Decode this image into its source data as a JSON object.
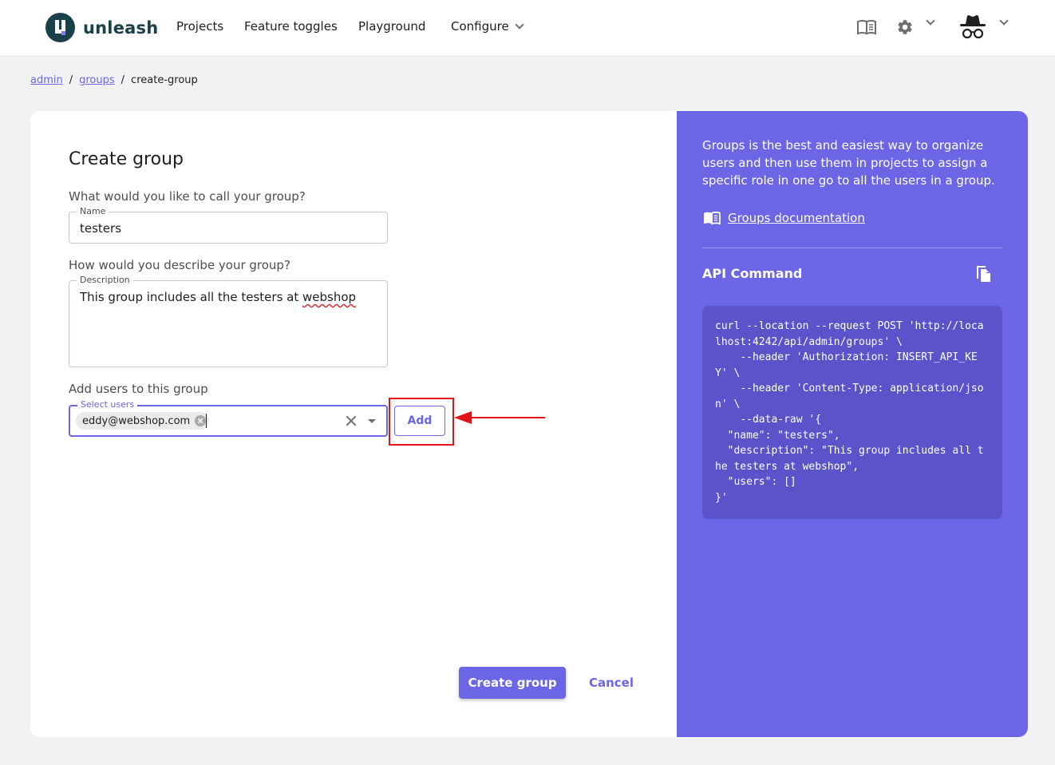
{
  "header": {
    "brand": "unleash",
    "nav": [
      "Projects",
      "Feature toggles",
      "Playground",
      "Configure"
    ]
  },
  "breadcrumb": {
    "items": [
      "admin",
      "groups"
    ],
    "current": "create-group",
    "separator": "/"
  },
  "form": {
    "title": "Create group",
    "name_question": "What would you like to call your group?",
    "name_label": "Name",
    "name_value": "testers",
    "desc_question": "How would you describe your group?",
    "desc_label": "Description",
    "desc_value_prefix": "This group includes all the testers at ",
    "desc_value_word": "webshop",
    "users_question": "Add users to this group",
    "users_label": "Select users",
    "selected_user": "eddy@webshop.com",
    "add_label": "Add",
    "create_label": "Create group",
    "cancel_label": "Cancel"
  },
  "panel": {
    "description": "Groups is the best and easiest way to organize users and then use them in projects to assign a specific role in one go to all the users in a group.",
    "doc_link": "Groups documentation",
    "api_title": "API Command",
    "api_code": "curl --location --request POST 'http://localhost:4242/api/admin/groups' \\\n    --header 'Authorization: INSERT_API_KEY' \\\n    --header 'Content-Type: application/json' \\\n    --data-raw '{\n  \"name\": \"testers\",\n  \"description\": \"This group includes all the testers at webshop\",\n  \"users\": []\n}'"
  },
  "colors": {
    "primary": "#6c65e5",
    "brand": "#1a4049",
    "annotation": "#e0141b"
  }
}
